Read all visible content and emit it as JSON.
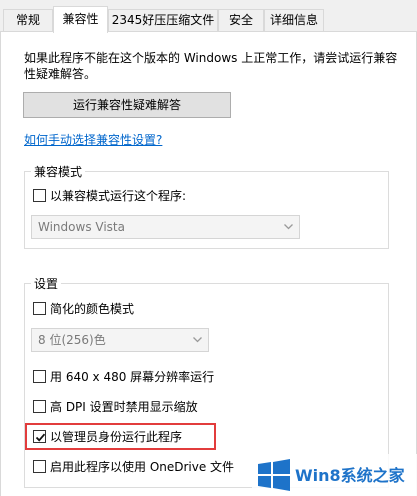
{
  "tabs": [
    {
      "label": "常规",
      "active": false
    },
    {
      "label": "兼容性",
      "active": true
    },
    {
      "label": "2345好压压缩文件",
      "active": false
    },
    {
      "label": "安全",
      "active": false
    },
    {
      "label": "详细信息",
      "active": false
    }
  ],
  "description": "如果此程序不能在这个版本的 Windows 上正常工作，请尝试运行兼容性疑难解答。",
  "troubleshoot_button": "运行兼容性疑难解答",
  "manual_link": "如何手动选择兼容性设置?",
  "compat_mode": {
    "legend": "兼容模式",
    "checkbox_label": "以兼容模式运行这个程序:",
    "checked": false,
    "os_select": "Windows Vista"
  },
  "settings": {
    "legend": "设置",
    "reduced_color_label": "简化的颜色模式",
    "reduced_color_checked": false,
    "color_select": "8 位(256)色",
    "res_640_label": "用 640 x 480 屏幕分辨率运行",
    "res_640_checked": false,
    "high_dpi_label": "高 DPI 设置时禁用显示缩放",
    "high_dpi_checked": false,
    "run_as_admin_label": "以管理员身份运行此程序",
    "run_as_admin_checked": true,
    "onedrive_label": "启用此程序以使用 OneDrive 文件",
    "onedrive_checked": false
  },
  "watermark": {
    "text": "Win8系统之家"
  },
  "colors": {
    "link": "#0066cc",
    "highlight_border": "#e23c3c",
    "watermark_blue": "#1e73c9"
  }
}
